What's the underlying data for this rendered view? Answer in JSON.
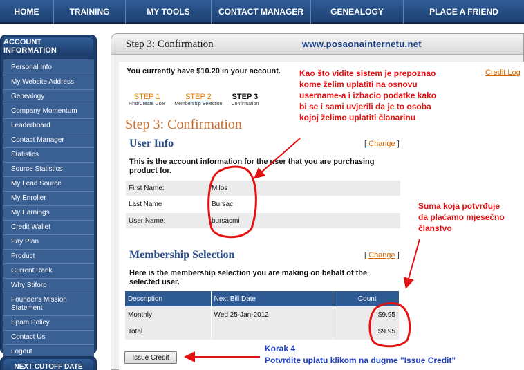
{
  "nav": [
    {
      "label": "HOME",
      "w": 80
    },
    {
      "label": "TRAINING",
      "w": 100
    },
    {
      "label": "MY TOOLS",
      "w": 126
    },
    {
      "label": "CONTACT MANAGER",
      "w": 142
    },
    {
      "label": "GENEALOGY",
      "w": 134
    },
    {
      "label": "PLACE A FRIEND",
      "w": 176
    }
  ],
  "sidebar": {
    "title": "ACCOUNT INFORMATION",
    "items": [
      "Personal Info",
      "My Website Address",
      "Genealogy",
      "Company Momentum",
      "Leaderboard",
      "Contact Manager",
      "Statistics",
      "Source Statistics",
      "My Lead Source",
      "My Enroller",
      "My Earnings",
      "Credit Wallet",
      "Pay Plan",
      "Product",
      "Current Rank",
      "Why Stiforp",
      "Founder's Mission Statement",
      "Spam Policy",
      "Contact Us",
      "Logout"
    ],
    "next_cutoff_title": "NEXT CUTOFF DATE"
  },
  "main": {
    "title": "Step 3: Confirmation",
    "watermark": "www.posaonainternetu.net",
    "balance_text": "You currently have $10.20 in your account.",
    "credit_log": "Credit Log",
    "steps": [
      {
        "label": "STEP 1",
        "sub": "Find/Create User"
      },
      {
        "label": "STEP 2",
        "sub": "Membership Selection"
      },
      {
        "label": "STEP 3",
        "sub": "Confirmation"
      }
    ],
    "big_title": "Step 3: Confirmation"
  },
  "user_info": {
    "title": "User Info",
    "change": "Change",
    "description": "This is the account information for the user that you are purchasing product for.",
    "rows": [
      {
        "label": "First Name:",
        "value": "Milos"
      },
      {
        "label": "Last Name",
        "value": "Bursac"
      },
      {
        "label": "User Name:",
        "value": "bursacmi"
      }
    ]
  },
  "membership": {
    "title": "Membership Selection",
    "change": "Change",
    "description": "Here is the membership selection you are making on behalf of the selected user.",
    "headers": [
      "Description",
      "Next Bill Date",
      "Count"
    ],
    "rows": [
      {
        "desc": "Monthly",
        "date": "Wed 25-Jan-2012",
        "count": "$9.95"
      },
      {
        "desc": "Total",
        "date": "",
        "count": "$9.95"
      }
    ]
  },
  "issue_button": "Issue Credit",
  "annotations": {
    "top_right": [
      "Kao što vidite sistem je prepoznao",
      "kome želim uplatiti na osnovu",
      "username-a i izbacio podatke kako",
      "bi se i sami uvjerili da je to osoba",
      "kojoj želimo uplatiti članarinu"
    ],
    "right_mid": [
      "Suma koja potvrđuje",
      "da plaćamo mjesečno",
      "članstvo"
    ],
    "bottom_title": "Korak 4",
    "bottom_text": "Potvrdite uplatu klikom na dugme \"Issue Credit\""
  },
  "colors": {
    "nav": "#2f5d96",
    "sidebar": "#1d3e6b",
    "accent_orange": "#d36a00",
    "annotation_red": "#e31212",
    "annotation_blue": "#1f3fbf"
  }
}
